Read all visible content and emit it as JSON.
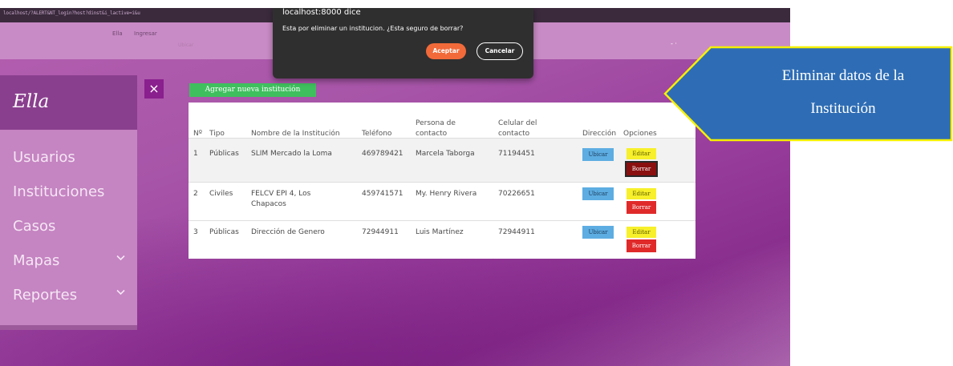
{
  "browser": {
    "url": "localhost/?ALERT&NT_login?host?dinst&i_lactive=i&u"
  },
  "navbar": {
    "brand": "Ella",
    "link": "Ingresar",
    "faint_text": "Ubicar",
    "dot": "- ·"
  },
  "sidebar": {
    "logo": "Ella",
    "items": [
      {
        "label": "Usuarios"
      },
      {
        "label": "Instituciones"
      },
      {
        "label": "Casos"
      },
      {
        "label": "Mapas",
        "expandable": true
      },
      {
        "label": "Reportes",
        "expandable": true
      }
    ]
  },
  "close_symbol": "×",
  "toolbar": {
    "add_label": "Agregar nueva institución"
  },
  "table": {
    "headers": {
      "num": "Nº",
      "tipo": "Tipo",
      "nombre": "Nombre de la Institución",
      "telefono": "Teléfono",
      "persona_l1": "Persona de",
      "persona_l2": "contacto",
      "celular_l1": "Celular del",
      "celular_l2": "contacto",
      "direccion": "Dirección",
      "opciones": "Opciones"
    },
    "rows": [
      {
        "num": "1",
        "tipo": "Públicas",
        "nombre_l1": "SLIM Mercado la Loma",
        "nombre_l2": "",
        "telefono": "469789421",
        "persona": "Marcela Taborga",
        "celular": "71194451"
      },
      {
        "num": "2",
        "tipo": "Civiles",
        "nombre_l1": "FELCV EPI 4, Los",
        "nombre_l2": "Chapacos",
        "telefono": "459741571",
        "persona": "My. Henry Rivera",
        "celular": "70226651"
      },
      {
        "num": "3",
        "tipo": "Públicas",
        "nombre_l1": "Dirección de Genero",
        "nombre_l2": "",
        "telefono": "72944911",
        "persona": "Luis Martínez",
        "celular": "72944911"
      }
    ],
    "ubicar_label": "Ubicar",
    "editar_label": "Editar",
    "borrar_label": "Borrar"
  },
  "dialog": {
    "title": "localhost:8000 dice",
    "message": "Esta por eliminar un institucion. ¿Esta seguro de borrar?",
    "accept_label": "Aceptar",
    "cancel_label": "Cancelar"
  },
  "callout": {
    "text_line1": "Eliminar datos de la",
    "text_line2": "Institución"
  },
  "colors": {
    "callout_fill": "#2e6db5",
    "callout_border": "#f5f000",
    "add_button": "#3fbf5e",
    "ubicar_button": "#5dade2",
    "editar_button": "#f7f02a",
    "borrar_button": "#e02a2a",
    "accept_button": "#f26a3a"
  }
}
